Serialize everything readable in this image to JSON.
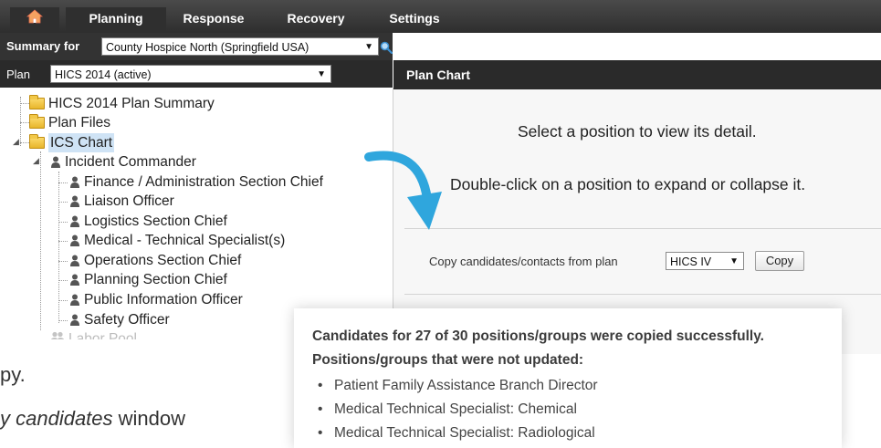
{
  "nav": {
    "tabs": [
      "Planning",
      "Response",
      "Recovery",
      "Settings"
    ],
    "active_tab": "Planning"
  },
  "summary": {
    "label": "Summary for",
    "selected": "County Hospice North (Springfield USA)"
  },
  "plan": {
    "label": "Plan",
    "selected": "HICS 2014 (active)"
  },
  "tree": {
    "items": [
      {
        "label": "HICS 2014 Plan Summary",
        "icon": "folder-icon"
      },
      {
        "label": "Plan Files",
        "icon": "folder-icon"
      },
      {
        "label": "ICS Chart",
        "icon": "folder-icon",
        "selected": true
      },
      {
        "label": "Incident Commander",
        "icon": "person-icon"
      },
      {
        "label": "Finance / Administration Section Chief",
        "icon": "person-icon"
      },
      {
        "label": "Liaison Officer",
        "icon": "person-icon"
      },
      {
        "label": "Logistics Section Chief",
        "icon": "person-icon"
      },
      {
        "label": "Medical - Technical Specialist(s)",
        "icon": "person-icon"
      },
      {
        "label": "Operations Section Chief",
        "icon": "person-icon"
      },
      {
        "label": "Planning Section Chief",
        "icon": "person-icon"
      },
      {
        "label": "Public Information Officer",
        "icon": "person-icon"
      },
      {
        "label": "Safety Officer",
        "icon": "person-icon"
      },
      {
        "label": "Labor Pool",
        "icon": "group-icon"
      }
    ]
  },
  "plan_chart": {
    "header": "Plan Chart",
    "msg1": "Select a position to view its detail.",
    "msg2": "Double-click on a position to expand or collapse it.",
    "copy_label": "Copy candidates/contacts from plan",
    "copy_select": "HICS IV",
    "copy_button": "Copy"
  },
  "body_text": {
    "line1": "py.",
    "line2_italic": "y candidates",
    "line2_rest": " window"
  },
  "result": {
    "line1": "Candidates for 27 of 30 positions/groups were copied successfully.",
    "line2": "Positions/groups that were not updated:",
    "items": [
      "Patient Family Assistance Branch Director",
      "Medical Technical Specialist: Chemical",
      "Medical Technical Specialist: Radiological"
    ]
  },
  "colors": {
    "nav_bg": "#3a3a3a",
    "selected_bg": "#cfe3f5",
    "arrow": "#2fa6dd",
    "folder": "#f2c847"
  }
}
